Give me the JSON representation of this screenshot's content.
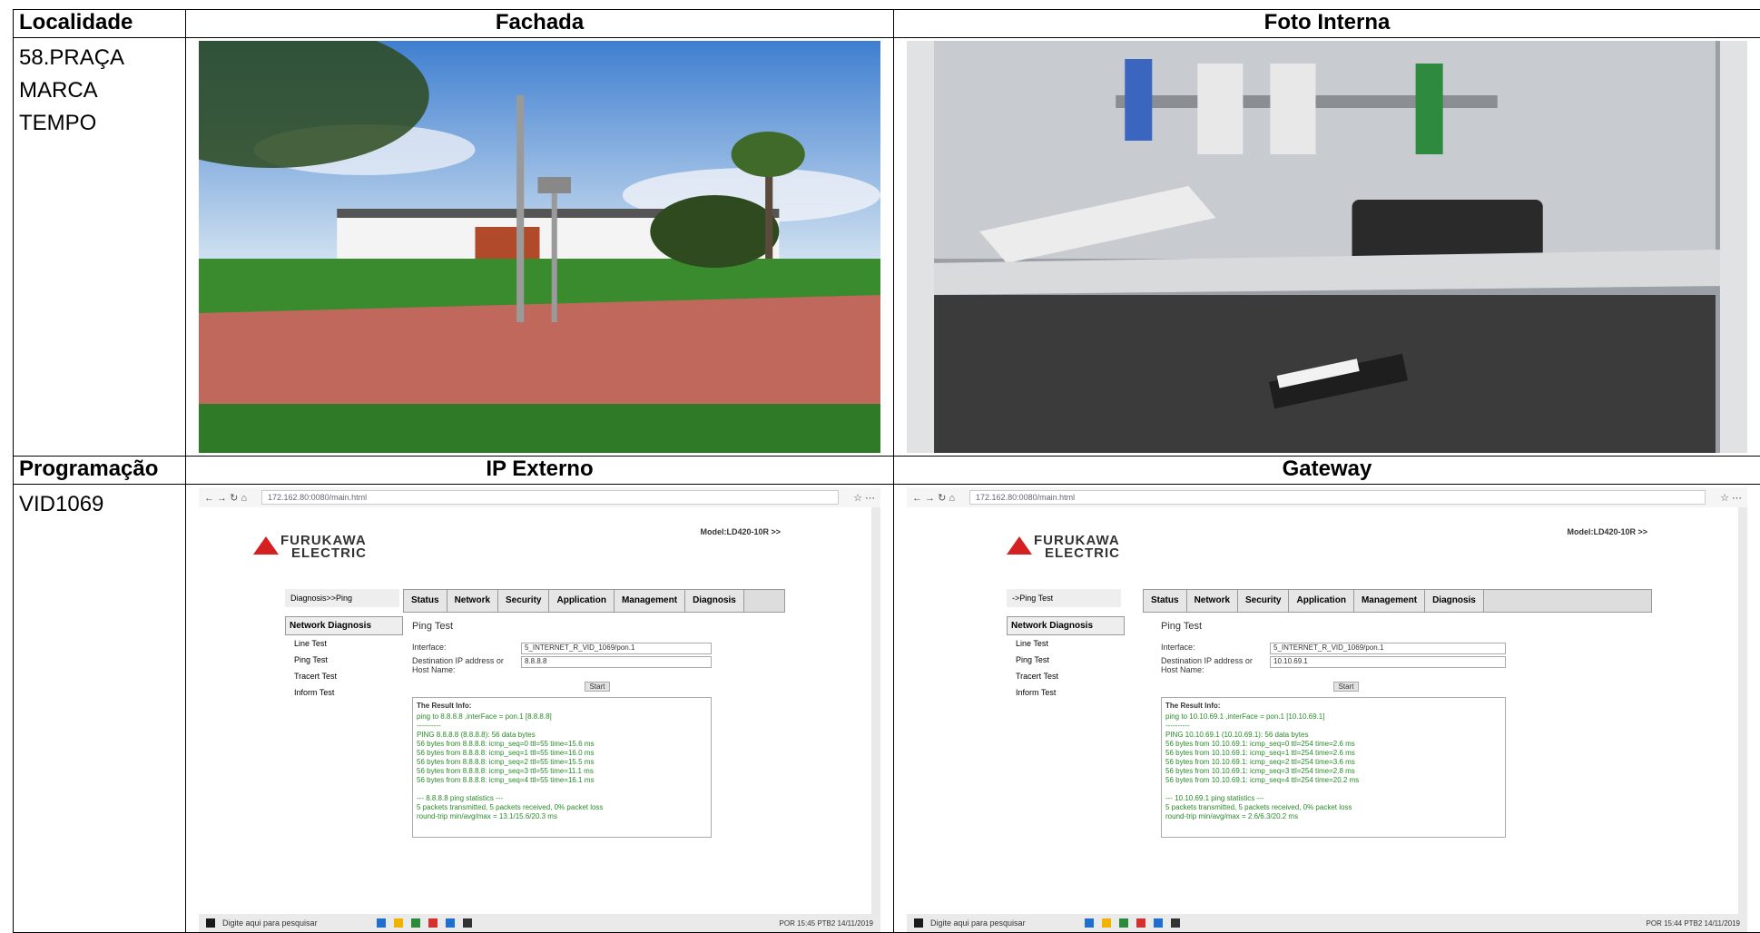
{
  "headers_row1": {
    "col1": "Localidade",
    "col2": "Fachada",
    "col3": "Foto Interna"
  },
  "localidade": [
    "58.PRAÇA",
    "MARCA",
    "TEMPO"
  ],
  "headers_row2": {
    "col1": "Programação",
    "col2": "IP Externo",
    "col3": "Gateway"
  },
  "programacao": "VID1069",
  "photos": {
    "fachada": "facade-photo",
    "foto_interna": "cabinet-interior-photo"
  },
  "ip_externo": {
    "address": "172.162.80:0080/main.html",
    "logo_line1": "FURUKAWA",
    "logo_line2": "ELECTRIC",
    "model": "Model:LD420-10R >>",
    "crumb": "Diagnosis>>Ping",
    "tabs": [
      "Status",
      "Network",
      "Security",
      "Application",
      "Management",
      "Diagnosis"
    ],
    "sidebar_section": "Network Diagnosis",
    "sidebar_items": [
      "Line Test",
      "Ping Test",
      "Tracert Test",
      "Inform Test"
    ],
    "content_title": "Ping Test",
    "interface_label": "Interface:",
    "interface_value": "5_INTERNET_R_VID_1069/pon.1",
    "dest_label": "Destination IP address or Host Name:",
    "dest_value": "8.8.8.8",
    "start_label": "Start",
    "result_title": "The Result Info:",
    "result_lines": [
      "ping to 8.8.8.8 ,interFace = pon.1 [8.8.8.8]",
      "----------",
      "PING 8.8.8.8 (8.8.8.8): 56 data bytes",
      "56 bytes from 8.8.8.8: icmp_seq=0 ttl=55 time=15.6 ms",
      "56 bytes from 8.8.8.8: icmp_seq=1 ttl=55 time=16.0 ms",
      "56 bytes from 8.8.8.8: icmp_seq=2 ttl=55 time=15.5 ms",
      "56 bytes from 8.8.8.8: icmp_seq=3 ttl=55 time=11.1 ms",
      "56 bytes from 8.8.8.8: icmp_seq=4 ttl=55 time=16.1 ms",
      "",
      "--- 8.8.8.8 ping statistics ---",
      "5 packets transmitted, 5 packets received, 0% packet loss",
      "round-trip min/avg/max = 13.1/15.6/20.3 ms"
    ],
    "taskbar_search": "Digite aqui para pesquisar",
    "clock": "POR 15:45 PTB2 14/11/2019"
  },
  "gateway": {
    "address": "172.162.80:0080/main.html",
    "logo_line1": "FURUKAWA",
    "logo_line2": "ELECTRIC",
    "model": "Model:LD420-10R >>",
    "crumb": "->Ping Test",
    "tabs": [
      "Status",
      "Network",
      "Security",
      "Application",
      "Management",
      "Diagnosis"
    ],
    "sidebar_section": "Network Diagnosis",
    "sidebar_items": [
      "Line Test",
      "Ping Test",
      "Tracert Test",
      "Inform Test"
    ],
    "content_title": "Ping Test",
    "interface_label": "Interface:",
    "interface_value": "5_INTERNET_R_VID_1069/pon.1",
    "dest_label": "Destination IP address or Host Name:",
    "dest_value": "10.10.69.1",
    "start_label": "Start",
    "result_title": "The Result Info:",
    "result_lines": [
      "ping to 10.10.69.1 ,interFace = pon.1 [10.10.69.1]",
      "----------",
      "PING 10.10.69.1 (10.10.69.1): 56 data bytes",
      "56 bytes from 10.10.69.1: icmp_seq=0 ttl=254 time=2.6 ms",
      "56 bytes from 10.10.69.1: icmp_seq=1 ttl=254 time=2.6 ms",
      "56 bytes from 10.10.69.1: icmp_seq=2 ttl=254 time=3.6 ms",
      "56 bytes from 10.10.69.1: icmp_seq=3 ttl=254 time=2.8 ms",
      "56 bytes from 10.10.69.1: icmp_seq=4 ttl=254 time=20.2 ms",
      "",
      "--- 10.10.69.1 ping statistics ---",
      "5 packets transmitted, 5 packets received, 0% packet loss",
      "round-trip min/avg/max = 2.6/6.3/20.2 ms"
    ],
    "taskbar_search": "Digite aqui para pesquisar",
    "clock": "POR 15:44 PTB2 14/11/2019"
  }
}
